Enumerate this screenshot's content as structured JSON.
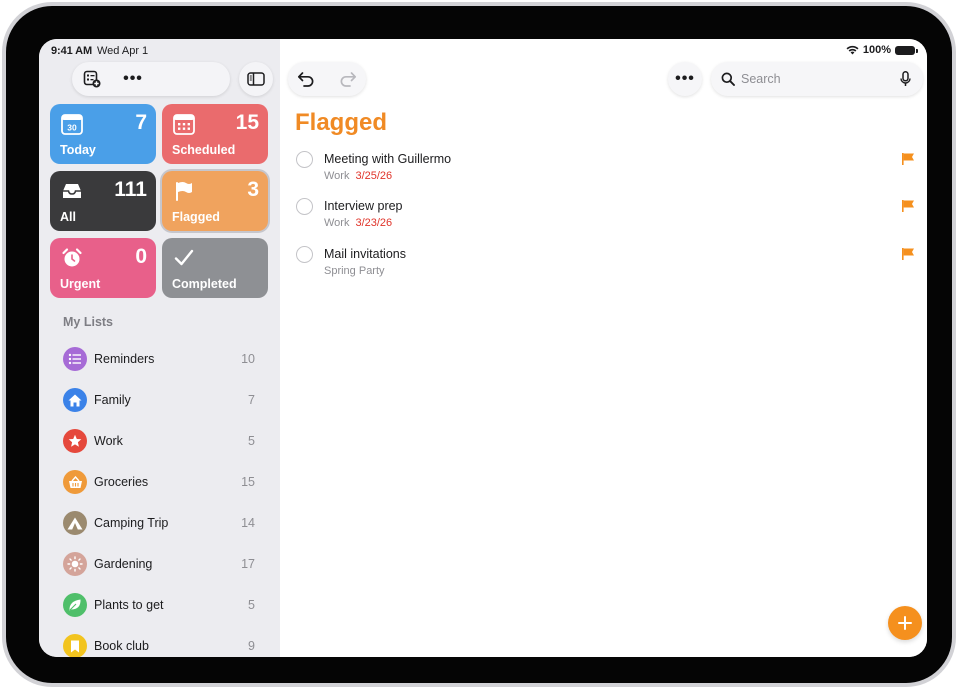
{
  "status_bar": {
    "time": "9:41 AM",
    "date": "Wed Apr 1",
    "battery": "100%"
  },
  "sidebar": {
    "tiles": [
      {
        "label": "Today",
        "count": "7",
        "color": "#4a9fe8",
        "icon": "calendar-icon",
        "day": "30"
      },
      {
        "label": "Scheduled",
        "count": "15",
        "color": "#ea6b6d",
        "icon": "calendar-grid-icon"
      },
      {
        "label": "All",
        "count": "111",
        "color": "#3a3a3c",
        "icon": "tray-icon"
      },
      {
        "label": "Flagged",
        "count": "3",
        "color": "#f0a35e",
        "icon": "flag-icon"
      },
      {
        "label": "Urgent",
        "count": "0",
        "color": "#e8608a",
        "icon": "alarm-icon"
      },
      {
        "label": "Completed",
        "count": "",
        "color": "#8e9094",
        "icon": "checkmark-icon"
      }
    ],
    "my_lists_title": "My Lists",
    "lists": [
      {
        "name": "Reminders",
        "count": "10",
        "color": "#a66bd6",
        "icon": "list-bullet-icon"
      },
      {
        "name": "Family",
        "count": "7",
        "color": "#3b82e8",
        "icon": "house-icon"
      },
      {
        "name": "Work",
        "count": "5",
        "color": "#e5483c",
        "icon": "star-icon"
      },
      {
        "name": "Groceries",
        "count": "15",
        "color": "#ef9a3a",
        "icon": "basket-icon"
      },
      {
        "name": "Camping Trip",
        "count": "14",
        "color": "#9b8a6f",
        "icon": "tent-icon"
      },
      {
        "name": "Gardening",
        "count": "17",
        "color": "#d4a49a",
        "icon": "sun-icon"
      },
      {
        "name": "Plants to get",
        "count": "5",
        "color": "#4fbf6a",
        "icon": "leaf-icon"
      },
      {
        "name": "Book club",
        "count": "9",
        "color": "#f2c41f",
        "icon": "bookmark-icon"
      }
    ]
  },
  "main": {
    "title": "Flagged",
    "search_placeholder": "Search",
    "reminders": [
      {
        "title": "Meeting with Guillermo",
        "list": "Work",
        "date": "3/25/26",
        "flagged": true
      },
      {
        "title": "Interview prep",
        "list": "Work",
        "date": "3/23/26",
        "flagged": true
      },
      {
        "title": "Mail invitations",
        "list": "Spring Party",
        "date": "",
        "flagged": true
      }
    ]
  },
  "colors": {
    "accent": "#f08a24",
    "flag": "#f5901e",
    "due_date": "#e0342a"
  }
}
